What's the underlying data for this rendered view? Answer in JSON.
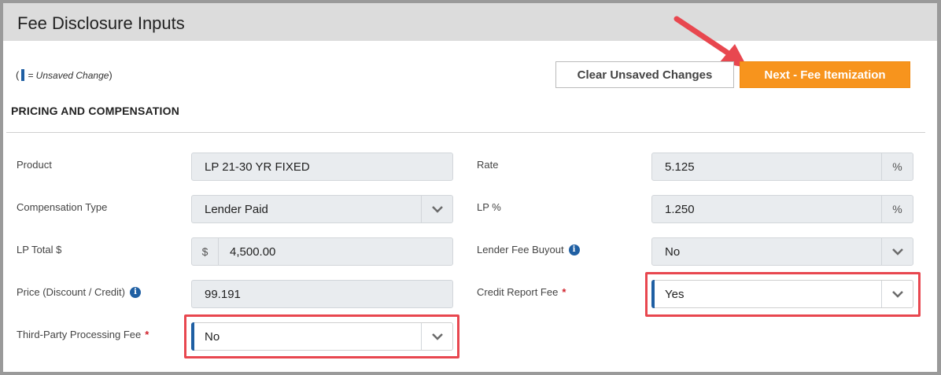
{
  "header": {
    "title": "Fee Disclosure Inputs"
  },
  "legend": {
    "open": "(",
    "text": "= Unsaved Change",
    "close": ")"
  },
  "buttons": {
    "clear": "Clear Unsaved Changes",
    "next": "Next - Fee Itemization"
  },
  "section": {
    "title": "PRICING AND COMPENSATION"
  },
  "fields": {
    "product": {
      "label": "Product",
      "value": "LP 21-30 YR FIXED"
    },
    "compensation_type": {
      "label": "Compensation Type",
      "value": "Lender Paid"
    },
    "lp_total": {
      "label": "LP Total $",
      "prefix": "$",
      "value": "4,500.00"
    },
    "price": {
      "label": "Price (Discount / Credit)",
      "value": "99.191"
    },
    "third_party_fee": {
      "label": "Third-Party Processing Fee",
      "required": "*",
      "value": "No"
    },
    "rate": {
      "label": "Rate",
      "value": "5.125",
      "suffix": "%"
    },
    "lp_percent": {
      "label": "LP %",
      "value": "1.250",
      "suffix": "%"
    },
    "lender_fee_buyout": {
      "label": "Lender Fee Buyout",
      "value": "No"
    },
    "credit_report_fee": {
      "label": "Credit Report Fee",
      "required": "*",
      "value": "Yes"
    }
  },
  "icons": {
    "info": "info-icon",
    "chevron": "chevron-down-icon",
    "arrow": "red-arrow-icon"
  },
  "colors": {
    "accent": "#f7941d",
    "unsaved": "#1f5fa3",
    "highlight": "#e8474f",
    "required": "#d0202a"
  }
}
